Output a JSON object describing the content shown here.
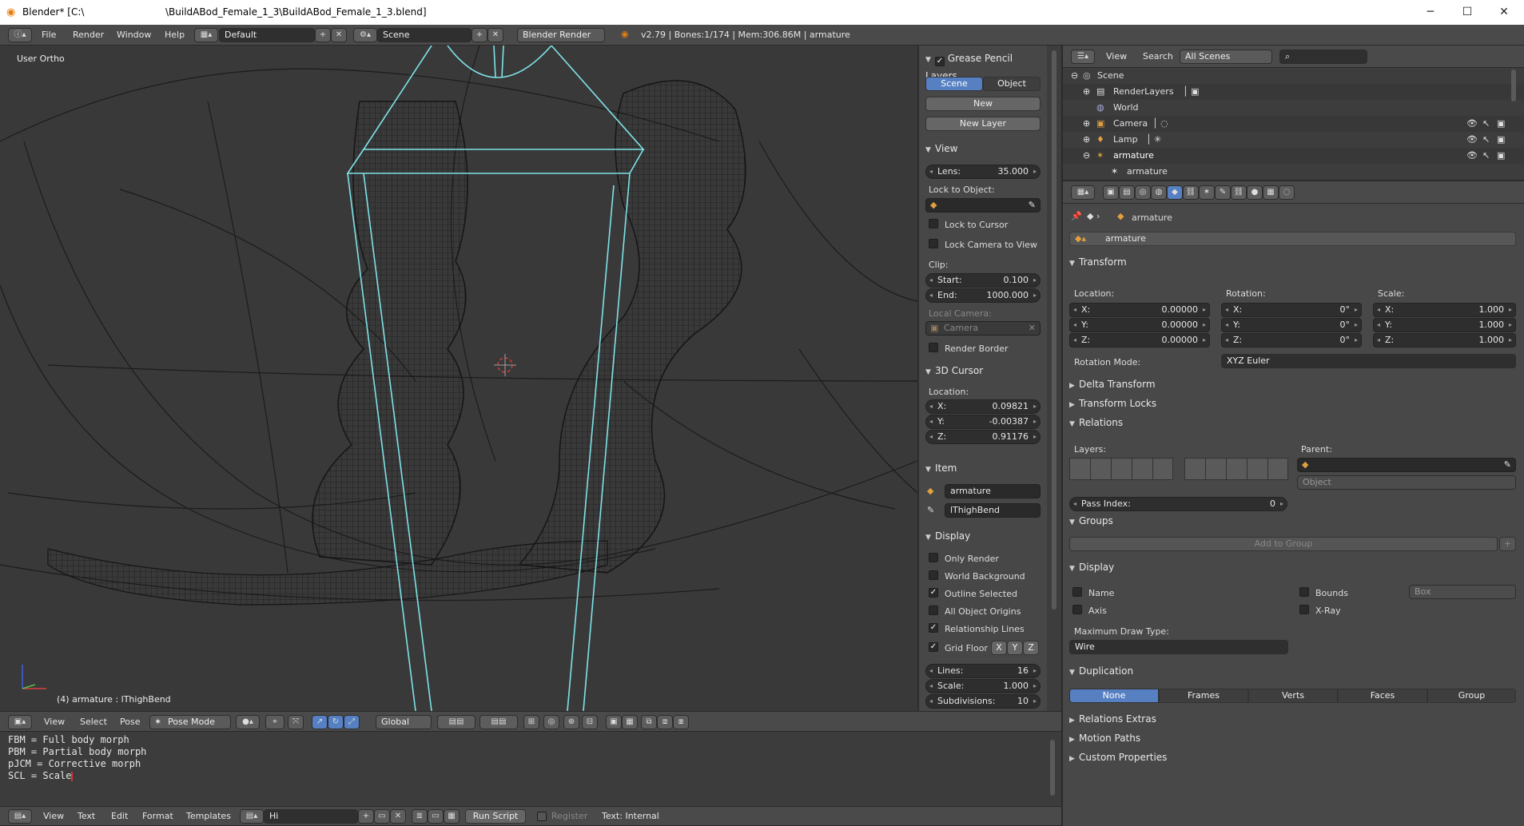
{
  "window": {
    "title": "Blender* [C:\\",
    "path": "\\BuildABod_Female_1_3\\BuildABod_Female_1_3.blend]",
    "minimize": "─",
    "maximize": "☐",
    "close": "✕"
  },
  "infobar": {
    "menus": [
      "File",
      "Render",
      "Window",
      "Help"
    ],
    "layout": "Default",
    "scene": "Scene",
    "engine": "Blender Render",
    "stats": "v2.79 | Bones:1/174 | Mem:306.86M | armature"
  },
  "viewport": {
    "view_label": "User Ortho",
    "object_label": "(4) armature : lThighBend"
  },
  "npanel": {
    "grease": {
      "title": "Grease Pencil Layers",
      "scene_btn": "Scene",
      "object_btn": "Object",
      "new_btn": "New",
      "new_layer_btn": "New Layer"
    },
    "view": {
      "title": "View",
      "lens_label": "Lens:",
      "lens": "35.000",
      "lock_label": "Lock to Object:",
      "lock_cursor": "Lock to Cursor",
      "lock_camera": "Lock Camera to View",
      "clip_label": "Clip:",
      "start_label": "Start:",
      "start": "0.100",
      "end_label": "End:",
      "end": "1000.000",
      "local_camera_label": "Local Camera:",
      "camera": "Camera",
      "render_border": "Render Border"
    },
    "cursor": {
      "title": "3D Cursor",
      "location_label": "Location:",
      "x_label": "X:",
      "x": "0.09821",
      "y_label": "Y:",
      "y": "-0.00387",
      "z_label": "Z:",
      "z": "0.91176"
    },
    "item": {
      "title": "Item",
      "object": "armature",
      "bone": "lThighBend"
    },
    "display": {
      "title": "Display",
      "only_render": "Only Render",
      "world_bg": "World Background",
      "outline_selected": "Outline Selected",
      "all_origins": "All Object Origins",
      "relationship_lines": "Relationship Lines",
      "grid_floor": "Grid Floor",
      "x": "X",
      "y": "Y",
      "z": "Z",
      "lines_label": "Lines:",
      "lines": "16",
      "scale_label": "Scale:",
      "scale": "1.000",
      "subdiv_label": "Subdivisions:",
      "subdiv": "10"
    }
  },
  "view3d_header": {
    "menus": [
      "View",
      "Select",
      "Pose"
    ],
    "mode": "Pose Mode",
    "orientation": "Global"
  },
  "text_editor": {
    "lines": [
      "FBM = Full body morph",
      "PBM = Partial body morph",
      "pJCM = Corrective morph",
      "SCL = Scale"
    ],
    "menus": [
      "View",
      "Text",
      "Edit",
      "Format",
      "Templates"
    ],
    "text_name": "Hi",
    "run_script": "Run Script",
    "register": "Register",
    "internal": "Text: Internal"
  },
  "outliner": {
    "view": "View",
    "search": "Search",
    "filter": "All Scenes",
    "items": [
      {
        "label": "Scene",
        "indent": 0
      },
      {
        "label": "RenderLayers",
        "indent": 1
      },
      {
        "label": "World",
        "indent": 1
      },
      {
        "label": "Camera",
        "indent": 1
      },
      {
        "label": "Lamp",
        "indent": 1
      },
      {
        "label": "armature",
        "indent": 1
      },
      {
        "label": "armature",
        "indent": 2
      }
    ]
  },
  "properties": {
    "object_name": "armature",
    "name_field": "armature",
    "transform": {
      "title": "Transform",
      "location": "Location:",
      "rotation": "Rotation:",
      "scale": "Scale:",
      "loc": [
        "0.00000",
        "0.00000",
        "0.00000"
      ],
      "rot": [
        "0°",
        "0°",
        "0°"
      ],
      "scl": [
        "1.000",
        "1.000",
        "1.000"
      ],
      "axes": [
        "X:",
        "Y:",
        "Z:"
      ],
      "rot_mode_label": "Rotation Mode:",
      "rot_mode": "XYZ Euler"
    },
    "delta": "Delta Transform",
    "locks": "Transform Locks",
    "relations": {
      "title": "Relations",
      "layers": "Layers:",
      "parent": "Parent:",
      "parent_type": "Object",
      "pass_label": "Pass Index:",
      "pass": "0"
    },
    "groups": {
      "title": "Groups",
      "add": "Add to Group"
    },
    "display": {
      "title": "Display",
      "name": "Name",
      "axis": "Axis",
      "bounds": "Bounds",
      "bounds_type": "Box",
      "xray": "X-Ray",
      "max_draw_label": "Maximum Draw Type:",
      "max_draw": "Wire"
    },
    "duplication": {
      "title": "Duplication",
      "options": [
        "None",
        "Frames",
        "Verts",
        "Faces",
        "Group"
      ]
    },
    "extras": "Relations Extras",
    "motion": "Motion Paths",
    "custom": "Custom Properties"
  }
}
